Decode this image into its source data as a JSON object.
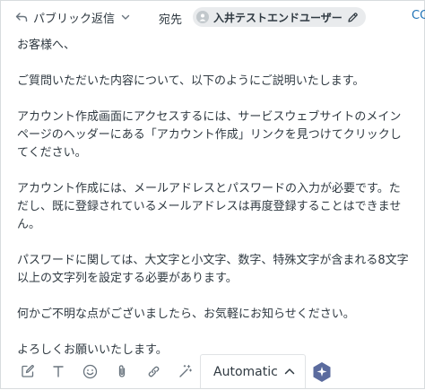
{
  "header": {
    "reply_type_label": "パブリック返信",
    "to_label": "宛先",
    "recipient_name": "入井テストエンドユーザー",
    "cc_label": "CC"
  },
  "body": {
    "paragraphs": [
      "お客様へ、",
      "ご質問いただいた内容について、以下のようにご説明いたします。",
      "アカウント作成画面にアクセスするには、サービスウェブサイトのメインページのヘッダーにある「アカウント作成」リンクを見つけてクリックしてください。",
      "アカウント作成には、メールアドレスとパスワードの入力が必要です。ただし、既に登録されているメールアドレスは再度登録することはできません。",
      "パスワードに関しては、大文字と小文字、数字、特殊文字が含まれる8文字以上の文字列を設定する必要があります。",
      "何かご不明な点がございましたら、お気軽にお知らせください。",
      "よろしくお願いいたします。"
    ]
  },
  "toolbar": {
    "mode_value": "Automatic",
    "icons": [
      "compose-icon",
      "text-format-icon",
      "emoji-icon",
      "attachment-icon",
      "link-icon",
      "magic-wand-icon",
      "ai-assist-icon"
    ]
  },
  "colors": {
    "text": "#2f3941",
    "link": "#1f73b7",
    "chip_bg": "#e9ebed",
    "icon": "#68737d"
  }
}
